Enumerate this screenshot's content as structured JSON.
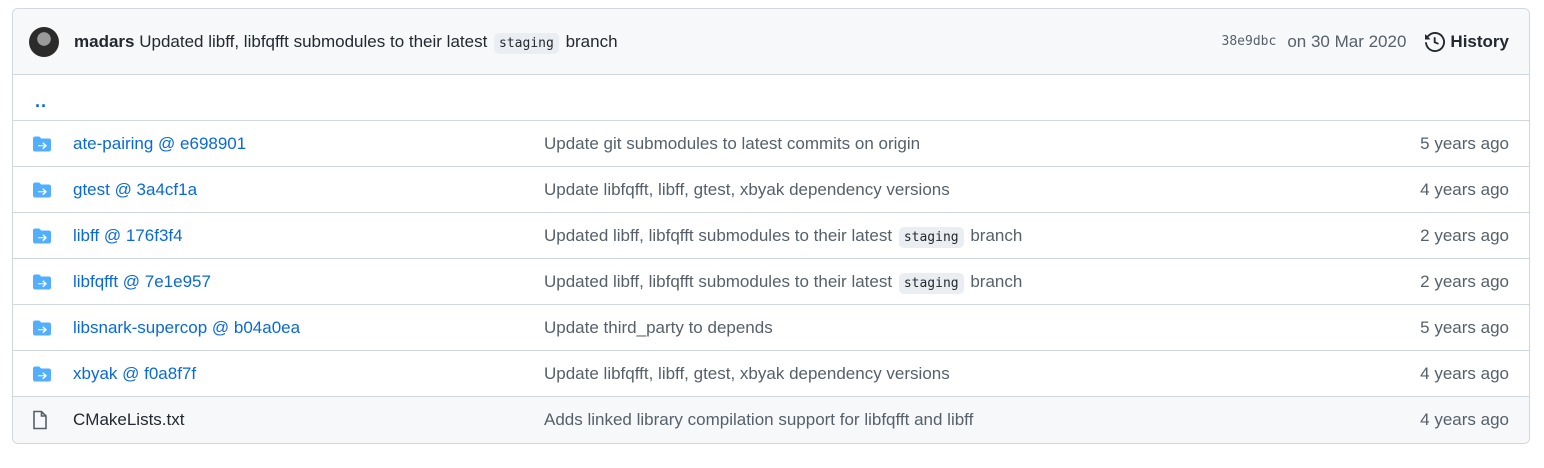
{
  "commit": {
    "author": "madars",
    "message_pre": "Updated libff, libfqfft submodules to their latest",
    "message_code": "staging",
    "message_post": "branch",
    "sha": "38e9dbc",
    "date": "on 30 Mar 2020",
    "history_label": "History"
  },
  "up_link": "..",
  "rows": [
    {
      "name": "ate-pairing @ e698901",
      "type": "submodule",
      "msg_pre": "Update git submodules to latest commits on origin",
      "msg_code": "",
      "msg_post": "",
      "age": "5 years ago"
    },
    {
      "name": "gtest @ 3a4cf1a",
      "type": "submodule",
      "msg_pre": "Update libfqfft, libff, gtest, xbyak dependency versions",
      "msg_code": "",
      "msg_post": "",
      "age": "4 years ago"
    },
    {
      "name": "libff @ 176f3f4",
      "type": "submodule",
      "msg_pre": "Updated libff, libfqfft submodules to their latest",
      "msg_code": "staging",
      "msg_post": "branch",
      "age": "2 years ago"
    },
    {
      "name": "libfqfft @ 7e1e957",
      "type": "submodule",
      "msg_pre": "Updated libff, libfqfft submodules to their latest",
      "msg_code": "staging",
      "msg_post": "branch",
      "age": "2 years ago"
    },
    {
      "name": "libsnark-supercop @ b04a0ea",
      "type": "submodule",
      "msg_pre": "Update third_party to depends",
      "msg_code": "",
      "msg_post": "",
      "age": "5 years ago"
    },
    {
      "name": "xbyak @ f0a8f7f",
      "type": "submodule",
      "msg_pre": "Update libfqfft, libff, gtest, xbyak dependency versions",
      "msg_code": "",
      "msg_post": "",
      "age": "4 years ago"
    },
    {
      "name": "CMakeLists.txt",
      "type": "file",
      "msg_pre": "Adds linked library compilation support for libfqfft and libff",
      "msg_code": "",
      "msg_post": "",
      "age": "4 years ago"
    }
  ],
  "colors": {
    "link": "#0969da",
    "folder_icon": "#54aeff",
    "muted": "#57606a",
    "border": "#d0d7de",
    "header_bg": "#f6f8fa"
  }
}
